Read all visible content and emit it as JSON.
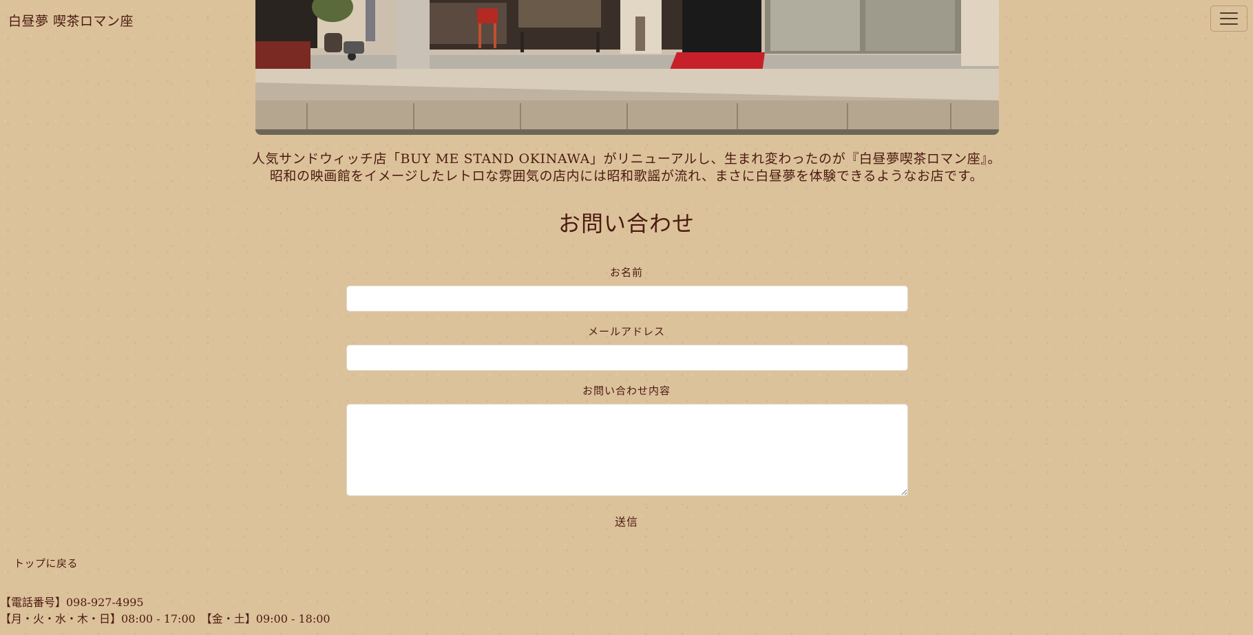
{
  "header": {
    "site_title": "白昼夢 喫茶ロマン座",
    "menu_icon": "hamburger-menu-icon"
  },
  "hero": {
    "image_semantic": "storefront-photo"
  },
  "intro": {
    "line1": "人気サンドウィッチ店「BUY ME STAND OKINAWA」がリニューアルし、生まれ変わったのが『白昼夢喫茶ロマン座』。",
    "line2": "昭和の映画館をイメージしたレトロな雰囲気の店内には昭和歌謡が流れ、まさに白昼夢を体験できるようなお店です。"
  },
  "contact": {
    "title": "お問い合わせ",
    "name_label": "お名前",
    "name_value": "",
    "email_label": "メールアドレス",
    "email_value": "",
    "message_label": "お問い合わせ内容",
    "message_value": "",
    "submit_label": "送信"
  },
  "footer": {
    "back_to_top": "トップに戻る",
    "phone": "【電話番号】098-927-4995",
    "hours": "【月・火・水・木・日】08:00 - 17:00　【金・土】09:00 - 18:00"
  },
  "colors": {
    "background": "#dcc29b",
    "text": "#4a1a10",
    "input_bg": "#ffffff"
  }
}
